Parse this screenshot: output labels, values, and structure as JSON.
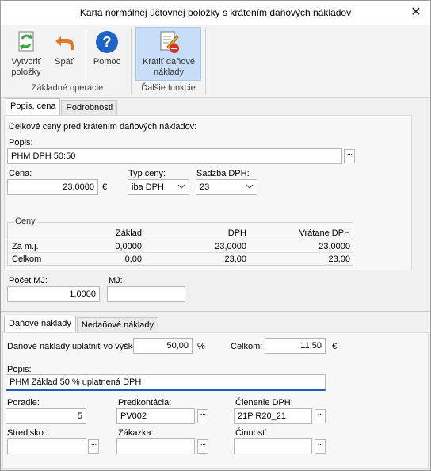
{
  "window": {
    "title": "Karta normálnej účtovnej položky s krátením daňových nákladov",
    "close": "✕"
  },
  "ribbon": {
    "btn_create": "Vytvoriť\npoložky",
    "btn_back": "Späť",
    "btn_help": "Pomoc",
    "btn_reduce": "Krátiť daňové\nnáklady",
    "group1": "Základné operácie",
    "group2": "Ďalšie funkcie"
  },
  "tabs_top": [
    "Popis, cena",
    "Podrobnosti"
  ],
  "top": {
    "heading": "Celkové ceny pred krátením daňových nákladov:",
    "popis_label": "Popis:",
    "popis_value": "PHM DPH 50:50",
    "cena_label": "Cena:",
    "cena_value": "23,0000",
    "currency": "€",
    "typ_label": "Typ ceny:",
    "typ_value": "iba DPH",
    "sadzba_label": "Sadzba DPH:",
    "sadzba_value": "23",
    "ceny_legend": "Ceny",
    "columns": [
      "Základ",
      "DPH",
      "Vrátane DPH"
    ],
    "rows": [
      {
        "label": "Za m.j.",
        "zaklad": "0,0000",
        "dph": "23,0000",
        "vratane": "23,0000"
      },
      {
        "label": "Celkom",
        "zaklad": "0,00",
        "dph": "23,00",
        "vratane": "23,00"
      }
    ],
    "pocet_label": "Počet MJ:",
    "pocet_value": "1,0000",
    "mj_label": "MJ:",
    "mj_value": ""
  },
  "tabs_bottom": [
    "Daňové náklady",
    "Nedaňové náklady"
  ],
  "bottom": {
    "uplatnit_label": "Daňové náklady uplatniť vo výške:",
    "uplatnit_value": "50,00",
    "percent": "%",
    "celkom_label": "Celkom:",
    "celkom_value": "11,50",
    "currency": "€",
    "popis_label": "Popis:",
    "popis_value": "PHM Základ 50 % uplatnená DPH",
    "poradie_label": "Poradie:",
    "poradie_value": "5",
    "predkontacia_label": "Predkontácia:",
    "predkontacia_value": "PV002",
    "clenenie_label": "Členenie DPH:",
    "clenenie_value": "21P R20_21",
    "stredisko_label": "Stredisko:",
    "stredisko_value": "",
    "zakazka_label": "Zákazka:",
    "zakazka_value": "",
    "cinnost_label": "Činnosť:",
    "cinnost_value": ""
  },
  "dots": "···"
}
